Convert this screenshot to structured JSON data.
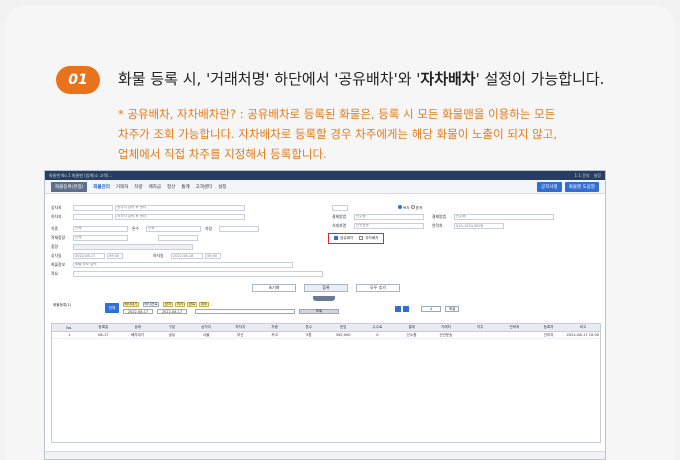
{
  "step": {
    "number": "01"
  },
  "headline": {
    "part1": "화물 등록 시, '거래처명' 하단에서 '공유배차'와 '",
    "bold": "자차배차",
    "part2": "' 설정이 가능합니다."
  },
  "note": {
    "line1": "* 공유배차, 자차배차란? : 공유배차로 등록된 화물은, 등록 시 모든 화물맨을 이용하는 모든",
    "line2": "차주가 조회 가능합니다. 자차배차로 등록할 경우 차주에게는 해당 화물이 노출이 되지 않고,",
    "line3": "업체에서 직접 차주를 지정해서 등록합니다."
  },
  "app": {
    "title": "화물맨 No.1 화물맨 (법계)소 고객/...",
    "titlebar_right": [
      "1:1 문의",
      "설정"
    ],
    "menu": {
      "current": "화물등록(본점)",
      "items": [
        "화물관리",
        "거래처",
        "차량",
        "배차금",
        "정산",
        "통계",
        "고객센터",
        "설정"
      ],
      "active_index": 0,
      "right_buttons": [
        "공지사항",
        "화물맨 도움말"
      ]
    },
    "form": {
      "left_labels": [
        "상차지",
        "하차지",
        "차종",
        "적재중량",
        "중량",
        "상차일",
        "화물정보",
        "적요"
      ],
      "placeholder_addr": "상차지 입력 후 엔터",
      "placeholder_addr2": "하차지 입력 후 엔터",
      "select_default": "선택",
      "weight_label": "톤수",
      "car_label": "차량",
      "date1": "2022-08-17",
      "time1": "09:00",
      "date2": "2022-08-18",
      "time2": "06:00",
      "unload_label": "하차일",
      "info_placeholder": "화물 정보 입력",
      "right_labels": [
        "결제방법",
        "거래처명",
        "운임"
      ],
      "payment_value": "인수증",
      "client_value": "신연운송",
      "phone_label": "연락처",
      "phone_value": "010-1234-5678",
      "share_label": "공유배차",
      "own_label": "자차배차",
      "radio_a": "독차",
      "radio_b": "혼적"
    },
    "actions": [
      "초기화",
      "등록",
      "모두 추가"
    ],
    "tools": {
      "left_label": "화물등록(1)",
      "chips": [
        "전체",
        "배차대기",
        "배차완료",
        "상차",
        "하차",
        "완료",
        "취소"
      ],
      "date_from": "2022-08-17",
      "date_to": "2022-08-17",
      "search_btn": "조회",
      "page": "4",
      "excel_btn": "엑셀"
    },
    "grid": {
      "headers": [
        "No.",
        "등록일",
        "상태",
        "구분",
        "상차지",
        "하차지",
        "차종",
        "톤수",
        "운임",
        "수수료",
        "결제",
        "거래처",
        "차주",
        "연락처",
        "등록자",
        "비고"
      ],
      "rows": [
        [
          "1",
          "08-17",
          "배차대기",
          "공유",
          "서울",
          "부산",
          "카고",
          "5톤",
          "350,000",
          "0",
          "인수증",
          "신연운송",
          "",
          "",
          "관리자",
          "2022-08-17 10:00"
        ]
      ]
    }
  }
}
